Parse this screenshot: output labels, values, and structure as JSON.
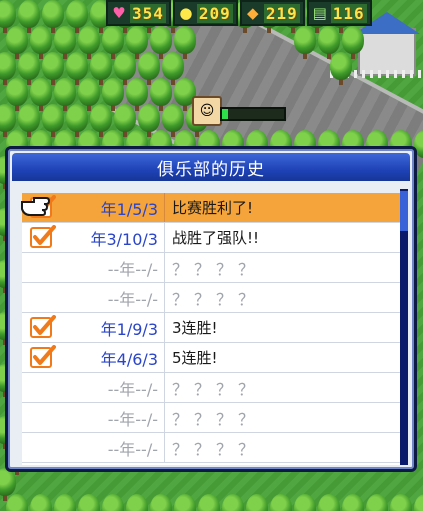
{
  "resources": [
    {
      "icon": "heart-icon",
      "glyph": "♥",
      "value": "354"
    },
    {
      "icon": "lightbulb-icon",
      "glyph": "●",
      "value": "209"
    },
    {
      "icon": "muscle-icon",
      "glyph": "◆",
      "value": "219"
    },
    {
      "icon": "field-icon",
      "glyph": "▤",
      "value": "116"
    }
  ],
  "dialog": {
    "title": "俱乐部的历史",
    "rows": [
      {
        "checked": true,
        "date": "年1/5/3",
        "description": "比赛胜利了!",
        "selected": true,
        "unknown": false
      },
      {
        "checked": true,
        "date": "年3/10/3",
        "description": "战胜了强队!!",
        "selected": false,
        "unknown": false
      },
      {
        "checked": false,
        "date": "--年--/-",
        "description": "？？？？",
        "selected": false,
        "unknown": true
      },
      {
        "checked": false,
        "date": "--年--/-",
        "description": "？？？？",
        "selected": false,
        "unknown": true
      },
      {
        "checked": true,
        "date": "年1/9/3",
        "description": "3连胜!",
        "selected": false,
        "unknown": false
      },
      {
        "checked": true,
        "date": "年4/6/3",
        "description": "5连胜!",
        "selected": false,
        "unknown": false
      },
      {
        "checked": false,
        "date": "--年--/-",
        "description": "？？？？",
        "selected": false,
        "unknown": true
      },
      {
        "checked": false,
        "date": "--年--/-",
        "description": "？？？？",
        "selected": false,
        "unknown": true
      },
      {
        "checked": false,
        "date": "--年--/-",
        "description": "？？？？",
        "selected": false,
        "unknown": true
      }
    ]
  },
  "avatar": {
    "progress": 0.1
  },
  "colors": {
    "selected_row": "#f4a43a",
    "header_blue": "#1f43b8",
    "date_blue": "#2a45c7",
    "check_orange": "#f07a1a"
  }
}
